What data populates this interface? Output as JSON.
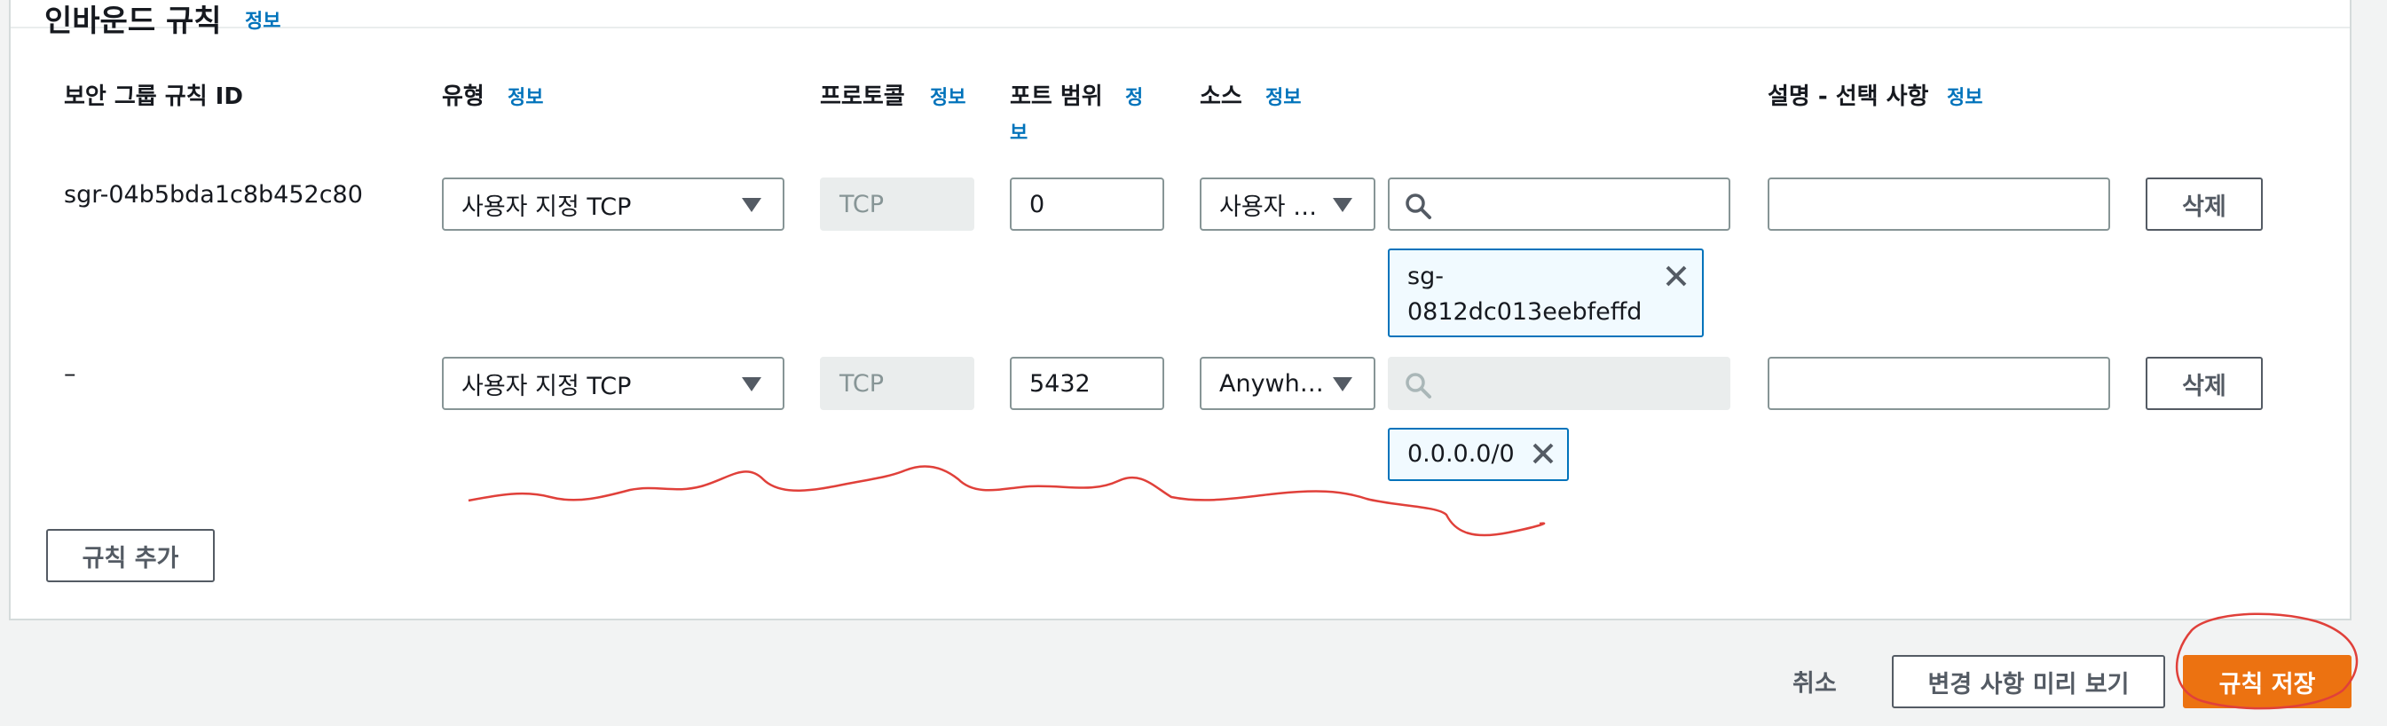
{
  "section": {
    "title": "인바운드 규칙",
    "info": "정보"
  },
  "columns": {
    "rule_id": "보안 그룹 규칙 ID",
    "type": "유형",
    "type_info": "정보",
    "protocol": "프로토콜",
    "protocol_info": "정보",
    "port_range": "포트 범위",
    "port_info_1": "정",
    "port_info_2": "보",
    "source": "소스",
    "source_info": "정보",
    "description": "설명 - 선택 사항",
    "description_info": "정보"
  },
  "rules": [
    {
      "rule_id": "sgr-04b5bda1c8b452c80",
      "type": "사용자 지정 TCP",
      "protocol": "TCP",
      "port_range": "0",
      "source_type": "사용자 …",
      "search_value": "",
      "token_line1": "sg-",
      "token_line2": "0812dc013eebfeffd",
      "description": "",
      "delete_label": "삭제"
    },
    {
      "rule_id": "–",
      "type": "사용자 지정 TCP",
      "protocol": "TCP",
      "port_range": "5432",
      "source_type": "Anywh…",
      "search_value": "",
      "token": "0.0.0.0/0",
      "description": "",
      "delete_label": "삭제"
    }
  ],
  "add_rule_label": "규칙 추가",
  "footer": {
    "cancel": "취소",
    "preview": "변경 사항 미리 보기",
    "save": "규칙 저장"
  },
  "colors": {
    "accent": "#ec7211",
    "link": "#0073bb",
    "annotation": "#e0403a"
  }
}
